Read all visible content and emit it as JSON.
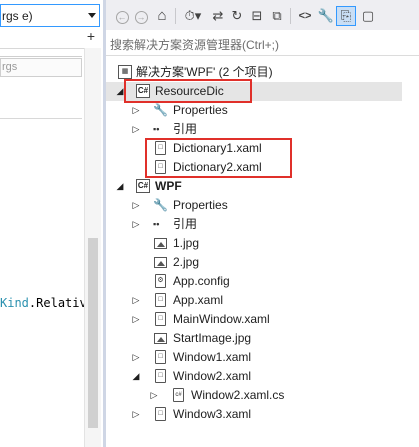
{
  "editor": {
    "member_dropdown_text": "rgs e)",
    "split_button_glyph": "+",
    "field_text": "rgs",
    "code_line": {
      "type": "Kind",
      "dot": ".",
      "member": "Relativ"
    }
  },
  "toolbar": {
    "buttons": [
      {
        "name": "back-icon",
        "glyph": "←"
      },
      {
        "name": "forward-icon",
        "glyph": "→"
      },
      {
        "name": "home-icon",
        "glyph": "⌂"
      },
      {
        "name": "history-icon",
        "glyph": "⟳"
      },
      {
        "name": "sync-icon",
        "glyph": "⇄"
      },
      {
        "name": "refresh-icon",
        "glyph": "↻"
      },
      {
        "name": "collapse-icon",
        "glyph": "⊟"
      },
      {
        "name": "show-all-files-icon",
        "glyph": "⧉"
      },
      {
        "name": "code-icon",
        "glyph": "<>"
      },
      {
        "name": "properties-wrench-icon",
        "glyph": "🔧"
      },
      {
        "name": "preview-icon",
        "glyph": "⎘"
      },
      {
        "name": "pending-changes-icon",
        "glyph": "▢"
      }
    ]
  },
  "search": {
    "placeholder": "搜索解决方案资源管理器(Ctrl+;)"
  },
  "tree": {
    "solution": {
      "label": "解决方案'WPF' (2 个项目)"
    },
    "items": [
      {
        "label": "ResourceDic",
        "icon": "csharp-project-icon",
        "expander": "expanded-arrow",
        "bold": false,
        "selected": true
      },
      {
        "label": "Properties",
        "icon": "wrench-icon",
        "expander": "collapsed-arrow"
      },
      {
        "label": "引用",
        "icon": "references-icon",
        "expander": "collapsed-arrow"
      },
      {
        "label": "Dictionary1.xaml",
        "icon": "xaml-file-icon",
        "expander": ""
      },
      {
        "label": "Dictionary2.xaml",
        "icon": "xaml-file-icon",
        "expander": ""
      },
      {
        "label": "WPF",
        "icon": "csharp-project-icon",
        "expander": "expanded-arrow",
        "bold": true
      },
      {
        "label": "Properties",
        "icon": "wrench-icon",
        "expander": "collapsed-arrow"
      },
      {
        "label": "引用",
        "icon": "references-icon",
        "expander": "collapsed-arrow"
      },
      {
        "label": "1.jpg",
        "icon": "image-file-icon",
        "expander": ""
      },
      {
        "label": "2.jpg",
        "icon": "image-file-icon",
        "expander": ""
      },
      {
        "label": "App.config",
        "icon": "config-file-icon",
        "expander": ""
      },
      {
        "label": "App.xaml",
        "icon": "xaml-file-icon",
        "expander": "collapsed-arrow"
      },
      {
        "label": "MainWindow.xaml",
        "icon": "xaml-file-icon",
        "expander": "collapsed-arrow"
      },
      {
        "label": "StartImage.jpg",
        "icon": "image-file-icon",
        "expander": ""
      },
      {
        "label": "Window1.xaml",
        "icon": "xaml-file-icon",
        "expander": "collapsed-arrow"
      },
      {
        "label": "Window2.xaml",
        "icon": "xaml-file-icon",
        "expander": "expanded-arrow"
      },
      {
        "label": "Window2.xaml.cs",
        "icon": "csharp-file-icon",
        "expander": "collapsed-arrow"
      },
      {
        "label": "Window3.xaml",
        "icon": "xaml-file-icon",
        "expander": "collapsed-arrow"
      }
    ]
  },
  "colors": {
    "highlight_box": "#e0302a",
    "selection": "#e5e5e5",
    "toolbar_bg": "#eeeef2",
    "code_type": "#2b91af"
  }
}
